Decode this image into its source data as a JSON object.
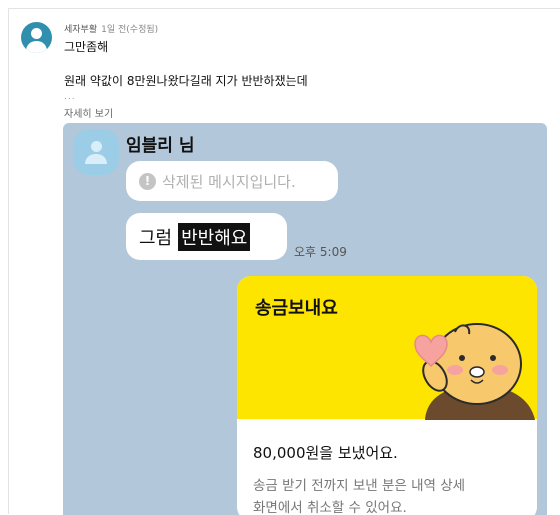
{
  "comment": {
    "author": "세자부활",
    "date": "1일 전(수정됨)",
    "line1": "그만좀해",
    "line2": "원래 약값이 8만원나왔다길래 지가 반반하쟀는데",
    "ellipsis": "...",
    "more_link": "자세히 보기"
  },
  "screenshot": {
    "sender": "임블리 님",
    "deleted_message": "삭제된 메시지입니다.",
    "message_plain": "그럼",
    "message_highlight": "반반해요",
    "time": "오후 5:09",
    "transfer_card": {
      "title": "송금보내요",
      "amount_text": "80,000원을 보냈어요.",
      "note_line1": "송금 받기 전까지 보낸 분은 내역 상세",
      "note_line2": "화면에서 취소할 수 있어요."
    }
  },
  "colors": {
    "chat_bg": "#b2c7da",
    "transfer_yellow": "#fee500",
    "avatar_blue": "#2f8fad"
  },
  "icons": [
    "user-avatar-icon",
    "profile-avatar-icon",
    "deleted-warning-icon",
    "lion-heart-sticker"
  ]
}
